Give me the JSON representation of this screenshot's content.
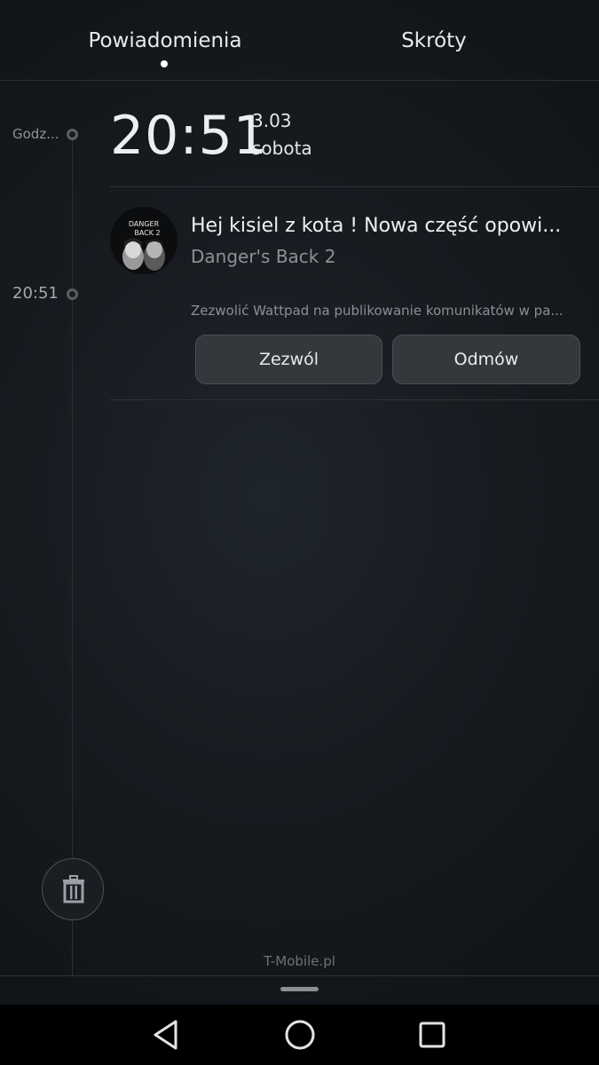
{
  "tabs": [
    {
      "label": "Powiadomienia",
      "active": true
    },
    {
      "label": "Skróty",
      "active": false
    }
  ],
  "timeline": {
    "header_label": "Godz...",
    "entry_time": "20:51"
  },
  "clock": {
    "time": "20:51",
    "date": "3.03",
    "weekday": "sobota"
  },
  "notification": {
    "avatar_text_line1": "DANGER",
    "avatar_text_line2": "BACK 2",
    "title": "Hej kisiel z kota ! Nowa część opowi...",
    "subtitle": "Danger's Back 2"
  },
  "permission": {
    "text": "Zezwolić Wattpad na publikowanie komunikatów w pa...",
    "allow_label": "Zezwól",
    "deny_label": "Odmów"
  },
  "carrier": "T-Mobile.pl",
  "icons": {
    "trash": "trash-icon",
    "back": "back-icon",
    "home": "home-icon",
    "recents": "recents-icon"
  },
  "colors": {
    "background": "#171b20",
    "button": "#34383d",
    "navbar": "#000000"
  }
}
